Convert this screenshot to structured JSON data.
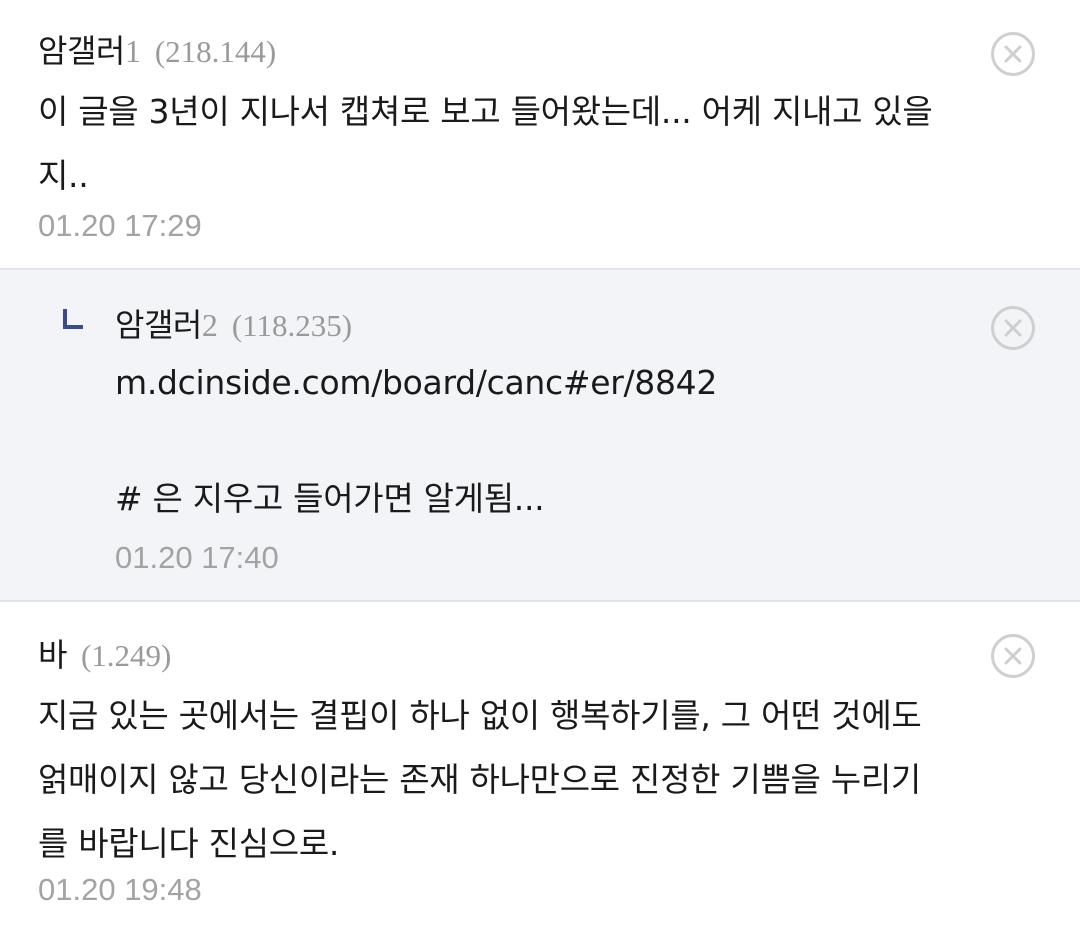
{
  "comments": [
    {
      "nickname": "암갤러",
      "nickname_suffix": "1",
      "ip": "(218.144)",
      "lines": [
        "이 글을 3년이 지나서 캡쳐로 보고 들어왔는데... 어케 지내고 있을",
        "지.."
      ],
      "date": "01.20 17:29",
      "is_reply": false
    },
    {
      "nickname": "암갤러",
      "nickname_suffix": "2",
      "ip": "(118.235)",
      "lines": [
        "m.dcinside.com/board/canc#er/8842",
        "",
        "# 은 지우고 들어가면 알게됨..."
      ],
      "date": "01.20 17:40",
      "is_reply": true
    },
    {
      "nickname": "바",
      "nickname_suffix": "",
      "ip": "(1.249)",
      "lines": [
        "지금 있는 곳에서는 결핍이 하나 없이 행복하기를, 그 어떤 것에도",
        "얽매이지 않고 당신이라는 존재 하나만으로 진정한 기쁨을 누리기",
        "를 바랍니다 진심으로."
      ],
      "date": "01.20 19:48",
      "is_reply": false
    }
  ],
  "icons": {
    "delete": "close-circle-icon",
    "reply": "reply-arrow-icon"
  },
  "colors": {
    "reply_background": "#f3f4f8",
    "reply_icon": "#3b4a8c",
    "meta_gray": "#9a9a9a"
  }
}
